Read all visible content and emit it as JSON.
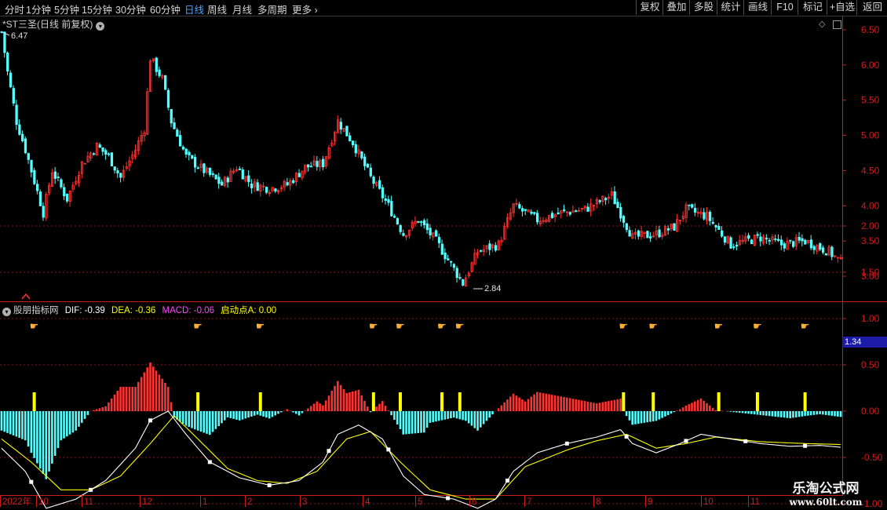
{
  "toolbar": {
    "periods": [
      "分时",
      "1分钟",
      "5分钟",
      "15分钟",
      "30分钟",
      "60分钟",
      "日线",
      "周线",
      "月线",
      "多周期",
      "更多"
    ],
    "active_period": "日线",
    "more_arrow": "›",
    "right_buttons": [
      "复权",
      "叠加",
      "多股",
      "统计",
      "画线",
      "F10",
      "标记",
      "+自选",
      "返回"
    ]
  },
  "stock": {
    "title": "*ST三圣(日线 前复权)",
    "high_label": "6.47",
    "low_label": "2.84"
  },
  "indicator": {
    "name": "股朋指标网",
    "dif": "DIF: -0.39",
    "dea": "DEA: -0.36",
    "macd": "MACD: -0.06",
    "start": "启动点A: 0.00",
    "tag_value": "1.34"
  },
  "colors": {
    "up": "#ff3232",
    "down": "#54ffff",
    "axis_red": "#c81e1e",
    "dif": "#ffffff",
    "dea": "#ffff00",
    "macd_label": "#ff44ff",
    "start_label": "#ffff00",
    "hand": "#ffb030"
  },
  "price_axis": [
    "6.50",
    "6.00",
    "5.50",
    "5.00",
    "4.50",
    "4.00",
    "3.50",
    "3.00"
  ],
  "macd_axis": [
    "2.00",
    "1.50",
    "1.00",
    "0.50",
    "0.00",
    "-0.50",
    "-1.00"
  ],
  "time_axis": [
    "2022年",
    "10",
    "11",
    "12",
    "1",
    "2",
    "3",
    "4",
    "5",
    "6",
    "7",
    "8",
    "9",
    "10",
    "11"
  ],
  "watermark": {
    "line1": "乐淘公式网",
    "line2": "www.60lt.com"
  },
  "chart_data": {
    "type": "candlestick",
    "price_range": [
      2.65,
      6.65
    ],
    "price_keypoints": [
      [
        0,
        6.47
      ],
      [
        2,
        5.9
      ],
      [
        5,
        5.2
      ],
      [
        8,
        4.8
      ],
      [
        12,
        4.2
      ],
      [
        14,
        3.9
      ],
      [
        17,
        4.5
      ],
      [
        22,
        4.1
      ],
      [
        27,
        4.6
      ],
      [
        32,
        4.85
      ],
      [
        36,
        4.7
      ],
      [
        40,
        4.4
      ],
      [
        45,
        4.8
      ],
      [
        48,
        5.1
      ],
      [
        50,
        6.1
      ],
      [
        54,
        5.8
      ],
      [
        57,
        5.2
      ],
      [
        62,
        4.7
      ],
      [
        68,
        4.5
      ],
      [
        74,
        4.3
      ],
      [
        79,
        4.55
      ],
      [
        84,
        4.3
      ],
      [
        90,
        4.25
      ],
      [
        96,
        4.3
      ],
      [
        102,
        4.55
      ],
      [
        108,
        4.6
      ],
      [
        113,
        5.2
      ],
      [
        118,
        4.9
      ],
      [
        124,
        4.4
      ],
      [
        130,
        4.0
      ],
      [
        135,
        3.6
      ],
      [
        140,
        3.8
      ],
      [
        146,
        3.5
      ],
      [
        152,
        3.1
      ],
      [
        155,
        2.9
      ],
      [
        160,
        3.35
      ],
      [
        167,
        3.45
      ],
      [
        172,
        4.0
      ],
      [
        180,
        3.8
      ],
      [
        188,
        3.9
      ],
      [
        196,
        3.95
      ],
      [
        205,
        4.15
      ],
      [
        212,
        3.55
      ],
      [
        220,
        3.6
      ],
      [
        226,
        3.7
      ],
      [
        230,
        3.95
      ],
      [
        237,
        3.85
      ],
      [
        245,
        3.45
      ],
      [
        255,
        3.55
      ],
      [
        262,
        3.45
      ],
      [
        270,
        3.5
      ],
      [
        278,
        3.35
      ],
      [
        282,
        3.2
      ]
    ],
    "macd_range": [
      -1.2,
      2.2
    ],
    "dif_keypoints": [
      [
        0,
        -0.4
      ],
      [
        8,
        -0.65
      ],
      [
        15,
        -1.05
      ],
      [
        25,
        -0.95
      ],
      [
        35,
        -0.75
      ],
      [
        45,
        -0.4
      ],
      [
        50,
        -0.1
      ],
      [
        56,
        0.0
      ],
      [
        62,
        -0.25
      ],
      [
        70,
        -0.55
      ],
      [
        80,
        -0.72
      ],
      [
        90,
        -0.8
      ],
      [
        100,
        -0.75
      ],
      [
        108,
        -0.55
      ],
      [
        113,
        -0.25
      ],
      [
        120,
        -0.15
      ],
      [
        128,
        -0.3
      ],
      [
        135,
        -0.7
      ],
      [
        142,
        -0.9
      ],
      [
        152,
        -0.95
      ],
      [
        160,
        -1.05
      ],
      [
        166,
        -0.95
      ],
      [
        172,
        -0.65
      ],
      [
        180,
        -0.45
      ],
      [
        190,
        -0.35
      ],
      [
        200,
        -0.28
      ],
      [
        208,
        -0.2
      ],
      [
        212,
        -0.35
      ],
      [
        220,
        -0.45
      ],
      [
        228,
        -0.35
      ],
      [
        235,
        -0.25
      ],
      [
        245,
        -0.3
      ],
      [
        255,
        -0.35
      ],
      [
        265,
        -0.38
      ],
      [
        275,
        -0.37
      ],
      [
        282,
        -0.39
      ]
    ],
    "dea_keypoints": [
      [
        0,
        -0.3
      ],
      [
        10,
        -0.55
      ],
      [
        20,
        -0.85
      ],
      [
        30,
        -0.85
      ],
      [
        40,
        -0.7
      ],
      [
        50,
        -0.35
      ],
      [
        58,
        -0.05
      ],
      [
        66,
        -0.3
      ],
      [
        76,
        -0.62
      ],
      [
        86,
        -0.75
      ],
      [
        96,
        -0.78
      ],
      [
        106,
        -0.65
      ],
      [
        116,
        -0.3
      ],
      [
        124,
        -0.22
      ],
      [
        134,
        -0.55
      ],
      [
        144,
        -0.85
      ],
      [
        156,
        -0.95
      ],
      [
        166,
        -0.95
      ],
      [
        176,
        -0.6
      ],
      [
        190,
        -0.42
      ],
      [
        200,
        -0.32
      ],
      [
        210,
        -0.25
      ],
      [
        220,
        -0.4
      ],
      [
        230,
        -0.35
      ],
      [
        240,
        -0.28
      ],
      [
        255,
        -0.33
      ],
      [
        270,
        -0.35
      ],
      [
        282,
        -0.36
      ]
    ],
    "signal_positions": [
      11,
      66,
      87,
      125,
      134,
      148,
      154,
      209,
      219,
      241,
      254,
      270
    ],
    "n_bars": 283
  }
}
